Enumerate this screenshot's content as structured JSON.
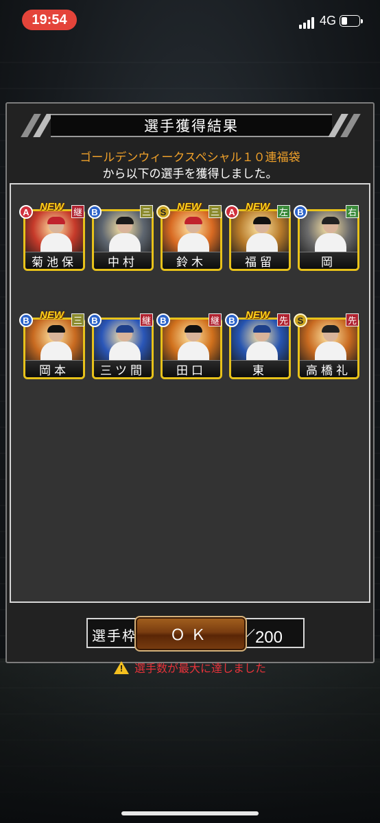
{
  "status_bar": {
    "time": "19:54",
    "network": "4G"
  },
  "dialog": {
    "title": "選手獲得結果",
    "message_line1": "ゴールデンウィークスペシャル１０連福袋",
    "message_line2": "から以下の選手を獲得しました。",
    "players": [
      {
        "name": "菊池保",
        "rank": "A",
        "position": "継",
        "new_badge": "NEW",
        "art_color": "#c63a2a",
        "cap_color": "#c0222c"
      },
      {
        "name": "中村",
        "rank": "B",
        "position": "三",
        "new_badge": "",
        "art_color": "#5e6670",
        "cap_color": "#1a1a1a"
      },
      {
        "name": "鈴木",
        "rank": "S",
        "position": "三",
        "new_badge": "NEW",
        "art_color": "#d86a22",
        "cap_color": "#c0222c"
      },
      {
        "name": "福留",
        "rank": "A",
        "position": "左",
        "new_badge": "NEW",
        "art_color": "#b77a2a",
        "cap_color": "#111111"
      },
      {
        "name": "岡",
        "rank": "B",
        "position": "右",
        "new_badge": "",
        "art_color": "#6b6b6b",
        "cap_color": "#222222"
      },
      {
        "name": "岡本",
        "rank": "B",
        "position": "三",
        "new_badge": "NEW",
        "art_color": "#c86a20",
        "cap_color": "#111111"
      },
      {
        "name": "三ツ間",
        "rank": "B",
        "position": "継",
        "new_badge": "",
        "art_color": "#2a56b8",
        "cap_color": "#1d3f8a"
      },
      {
        "name": "田口",
        "rank": "B",
        "position": "継",
        "new_badge": "",
        "art_color": "#d0701c",
        "cap_color": "#111111"
      },
      {
        "name": "東",
        "rank": "B",
        "position": "先",
        "new_badge": "NEW",
        "art_color": "#2654b0",
        "cap_color": "#1d3f8a"
      },
      {
        "name": "高橋礼",
        "rank": "S",
        "position": "先",
        "new_badge": "",
        "art_color": "#c86a20",
        "cap_color": "#222222"
      }
    ],
    "roster_label": "選手枠：",
    "roster_count": "200／200",
    "warning_text": "選手数が最大に達しました",
    "ok_label": "ＯＫ"
  }
}
